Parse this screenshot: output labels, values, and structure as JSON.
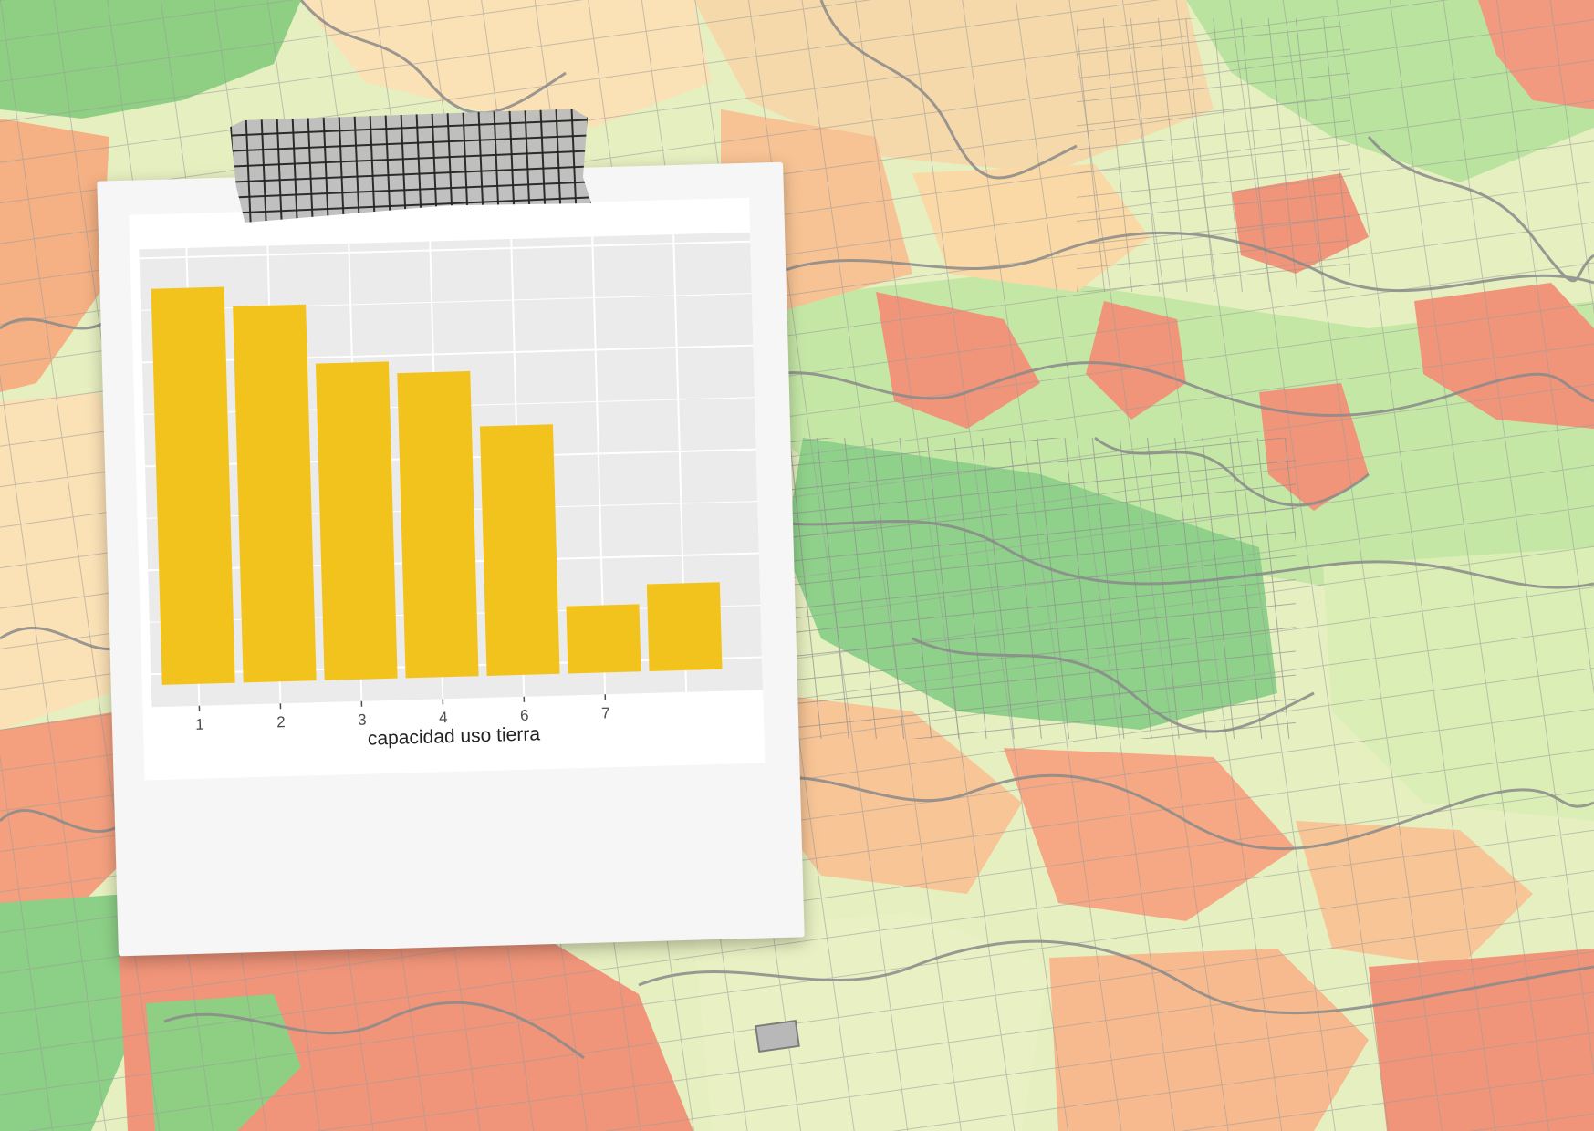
{
  "chart_data": {
    "type": "bar",
    "categories": [
      "1",
      "2",
      "3",
      "4",
      "6",
      "7",
      ""
    ],
    "values": [
      100,
      95,
      80,
      77,
      63,
      17,
      22
    ],
    "xlabel": "capacidad uso tierra",
    "ylabel": "",
    "ylim": [
      0,
      105
    ],
    "grid": true,
    "legend": "none",
    "bar_color": "#f2c31d",
    "panel_color": "#ebebeb"
  },
  "background": {
    "description_icon": "land-capability-map",
    "colors": [
      "#e9f2c4",
      "#a8d88f",
      "#f3a27e",
      "#f9cf9d",
      "#7fc47f",
      "#888888"
    ]
  },
  "decor": {
    "tape_icon": "grid-tape-icon"
  }
}
